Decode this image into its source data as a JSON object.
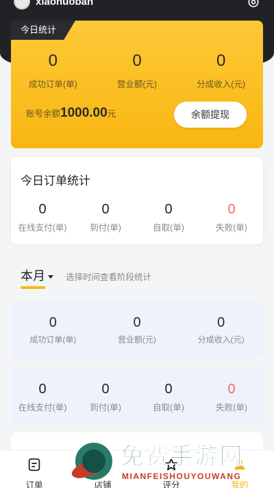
{
  "header": {
    "username": "xiaohuoban"
  },
  "today": {
    "tag": "今日统计",
    "stats": [
      {
        "value": "0",
        "label": "成功订单(单)"
      },
      {
        "value": "0",
        "label": "营业额(元)"
      },
      {
        "value": "0",
        "label": "分成收入(元)"
      }
    ],
    "balance_label": "账号余额",
    "balance_value": "1000.00",
    "balance_unit": "元",
    "withdraw_label": "余额提现"
  },
  "order_stats": {
    "title": "今日订单统计",
    "stats": [
      {
        "value": "0",
        "label": "在线支付(单)"
      },
      {
        "value": "0",
        "label": "到付(单)"
      },
      {
        "value": "0",
        "label": "自取(单)"
      },
      {
        "value": "0",
        "label": "失败(单)"
      }
    ]
  },
  "month": {
    "selector_label": "本月",
    "hint": "选择时间查看阶段统计",
    "stats": [
      {
        "value": "0",
        "label": "成功订单(单)"
      },
      {
        "value": "0",
        "label": "营业额(元)"
      },
      {
        "value": "0",
        "label": "分成收入(元)"
      }
    ],
    "order_stats": [
      {
        "value": "0",
        "label": "在线支付(单)"
      },
      {
        "value": "0",
        "label": "到付(单)"
      },
      {
        "value": "0",
        "label": "自取(单)"
      },
      {
        "value": "0",
        "label": "失败(单)"
      }
    ]
  },
  "tabbar": {
    "items": [
      {
        "label": "订单",
        "icon": "order-icon"
      },
      {
        "label": "店铺",
        "icon": "shop-icon"
      },
      {
        "label": "评分",
        "icon": "star-icon"
      },
      {
        "label": "我的",
        "icon": "user-icon"
      }
    ]
  },
  "watermark": {
    "cn": "免费手游网",
    "en": "MIANFEISHOUYOUWANG"
  },
  "colors": {
    "accent": "#f9b612",
    "dark": "#202226",
    "fail": "#f06a6a",
    "card_tint": "#eef2fb"
  }
}
